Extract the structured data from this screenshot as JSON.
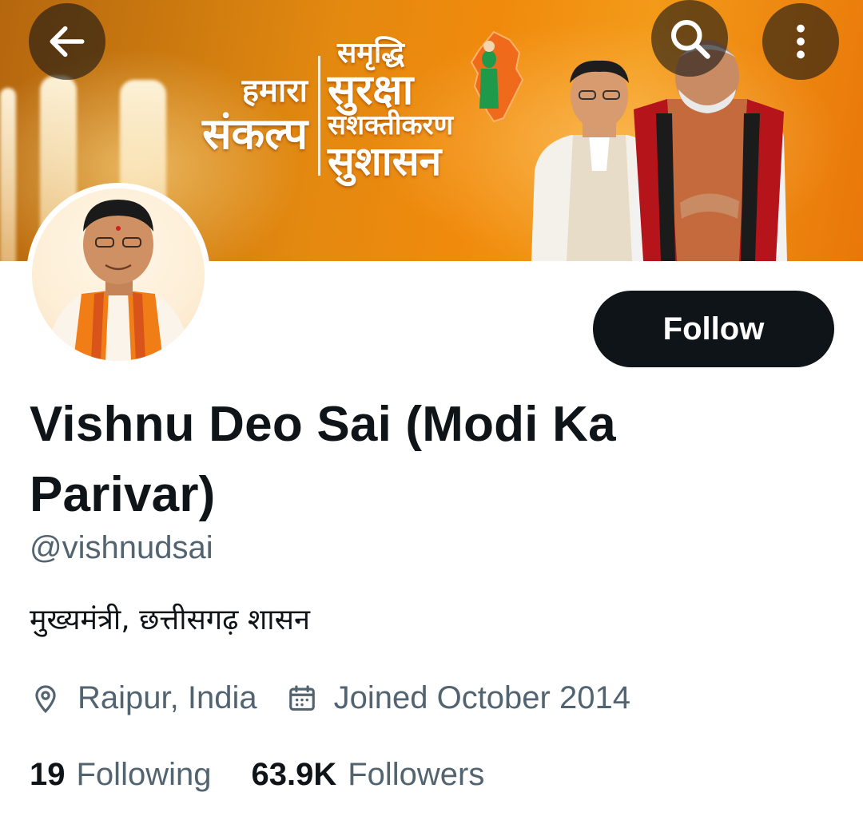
{
  "banner": {
    "left_line1": "हमारा",
    "left_line2": "संकल्प",
    "right_line1": "समृद्धि",
    "right_line2": "सुरक्षा",
    "right_line3": "सशक्तीकरण",
    "right_line4": "सुशासन"
  },
  "nav": {
    "back_icon": "arrow-left-icon",
    "search_icon": "search-icon",
    "more_icon": "more-vertical-icon"
  },
  "profile": {
    "display_name": "Vishnu Deo Sai (Modi Ka Parivar)",
    "handle": "@vishnudsai",
    "bio": "मुख्यमंत्री, छत्तीसगढ़ शासन",
    "location": "Raipur, India",
    "joined": "Joined October 2014",
    "follow_label": "Follow"
  },
  "stats": {
    "following_count": "19",
    "following_label": "Following",
    "followers_count": "63.9K",
    "followers_label": "Followers"
  },
  "colors": {
    "text_primary": "#0f1419",
    "text_secondary": "#536471",
    "button_bg": "#0f1419",
    "banner_orange": "#f08a0c"
  }
}
